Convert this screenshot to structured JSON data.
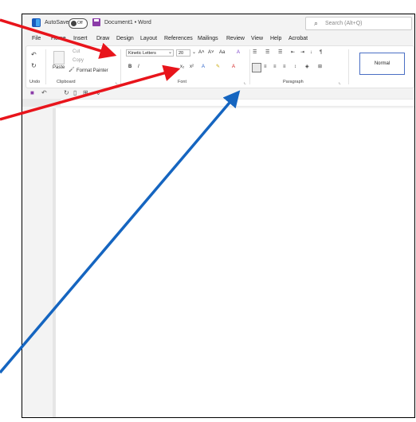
{
  "titlebar": {
    "autosave_label": "AutoSave",
    "autosave_state": "Off",
    "doc_title": "Document1 • Word",
    "search_placeholder": "Search (Alt+Q)"
  },
  "tabs": [
    "File",
    "Home",
    "Insert",
    "Draw",
    "Design",
    "Layout",
    "References",
    "Mailings",
    "Review",
    "View",
    "Help",
    "Acrobat"
  ],
  "ribbon": {
    "clipboard": {
      "paste": "Paste",
      "cut": "Cut",
      "copy": "Copy",
      "format_painter": "Format Painter",
      "label": "Clipboard"
    },
    "undo_label": "Undo",
    "font": {
      "name": "Kinetic Letters",
      "size": "20",
      "label": "Font"
    },
    "paragraph_label": "Paragraph",
    "styles": {
      "normal": "Normal"
    }
  },
  "colors": {
    "word_blue": "#185abd",
    "red_arrow": "#e8141b",
    "blue_arrow": "#1565c0"
  }
}
